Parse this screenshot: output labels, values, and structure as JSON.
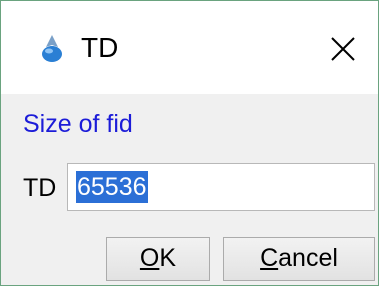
{
  "window": {
    "title": "TD",
    "app_icon": "topspin-app-icon",
    "close_icon": "close-icon"
  },
  "section": {
    "label": "Size of fid"
  },
  "field": {
    "label": "TD",
    "value": "65536",
    "selected": true
  },
  "buttons": {
    "ok": {
      "mnemonic": "O",
      "rest": "K"
    },
    "cancel": {
      "mnemonic": "C",
      "rest": "ancel"
    }
  },
  "colors": {
    "border": "#6aa37f",
    "section_label": "#1c1cd8",
    "selection": "#2b6fd6"
  }
}
